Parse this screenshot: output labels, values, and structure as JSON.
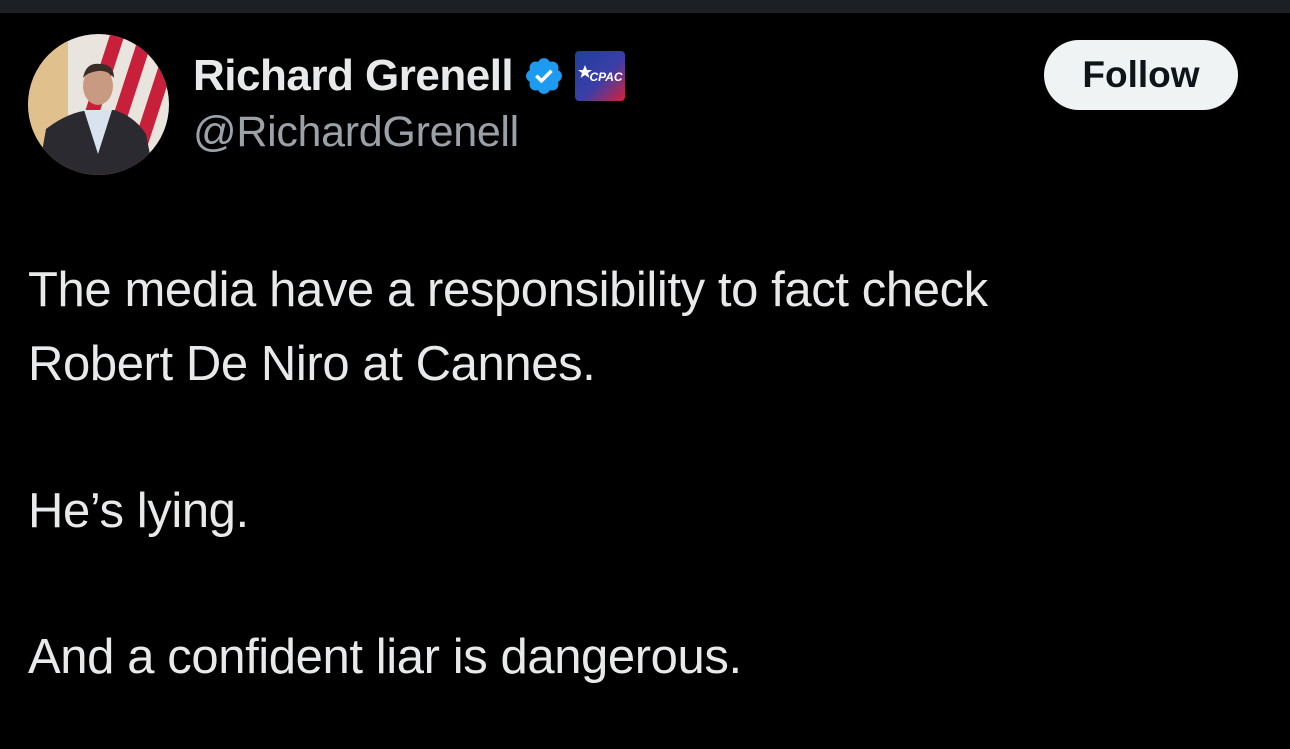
{
  "author": {
    "display_name": "Richard Grenell",
    "handle": "@RichardGrenell",
    "verified_icon": "verified-badge-icon",
    "affiliate_badge": {
      "label": "CPAC",
      "icon": "cpac-affiliate-badge-icon"
    }
  },
  "actions": {
    "follow_label": "Follow"
  },
  "tweet": {
    "lines": [
      "The media have a responsibility to fact check",
      "Robert De Niro at Cannes.",
      "He’s lying.",
      "And a confident liar is dangerous."
    ]
  },
  "colors": {
    "background": "#000000",
    "text_primary": "#e7e9ea",
    "text_secondary": "#9aa1a8",
    "verified_blue": "#1d9bf0",
    "follow_button_bg": "#eff3f4",
    "follow_button_text": "#0f1419"
  }
}
